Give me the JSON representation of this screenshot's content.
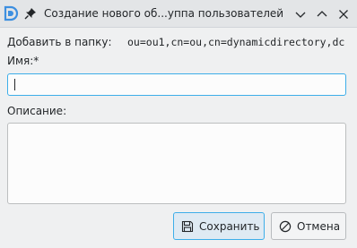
{
  "window": {
    "title": "Создание нового об...уппа пользователей",
    "app_icon": "app-logo-icon",
    "pin_icon": "pin-icon",
    "controls": [
      "minimize-icon",
      "maximize-icon",
      "close-icon"
    ]
  },
  "form": {
    "add_to_folder_label": "Добавить в папку:",
    "add_to_folder_value": "ou=ou1,cn=ou,cn=dynamicdirectory,dc",
    "name_label": "Имя:*",
    "name_value": "",
    "description_label": "Описание:",
    "description_value": ""
  },
  "buttons": {
    "save_label": "Сохранить",
    "save_icon": "save-icon",
    "cancel_label": "Отмена",
    "cancel_icon": "cancel-icon"
  },
  "colors": {
    "focus_accent": "#3daee9",
    "window_bg": "#eff0f1",
    "field_bg": "#fcfcfc"
  }
}
